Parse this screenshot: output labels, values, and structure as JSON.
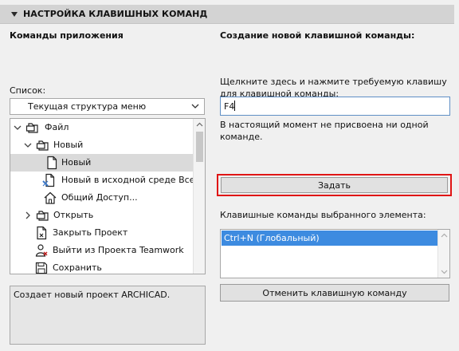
{
  "header": {
    "title": "НАСТРОЙКА КЛАВИШНЫХ КОМАНД"
  },
  "left": {
    "heading": "Команды приложения",
    "list_label": "Список:",
    "dropdown_value": "Текущая структура меню",
    "tree": [
      {
        "label": "Файл",
        "icon": "folder-icon",
        "expander": "chevron-down"
      },
      {
        "label": "Новый",
        "icon": "folder-icon",
        "expander": "chevron-down"
      },
      {
        "label": "Новый",
        "icon": "document-icon",
        "expander": "",
        "selected": true
      },
      {
        "label": "Новый в исходной среде Все",
        "icon": "new-doc-icon",
        "expander": ""
      },
      {
        "label": "Общий Доступ...",
        "icon": "house-icon",
        "expander": ""
      },
      {
        "label": "Открыть",
        "icon": "folder-icon",
        "expander": "chevron-right"
      },
      {
        "label": "Закрыть Проект",
        "icon": "close-doc-icon",
        "expander": ""
      },
      {
        "label": "Выйти из Проекта Teamwork",
        "icon": "user-exit-icon",
        "expander": ""
      },
      {
        "label": "Сохранить",
        "icon": "save-icon",
        "expander": ""
      }
    ],
    "description": "Создает новый проект ARCHICAD."
  },
  "right": {
    "heading": "Создание новой клавишной команды:",
    "instruction": "Щелкните здесь и нажмите требуемую клавишу для клавишной команды:",
    "key_input_value": "F4",
    "status_text": "В настоящий момент не присвоена ни одной команде.",
    "set_button_label": "Задать",
    "shortcuts_label": "Клавишные команды выбранного элемента:",
    "shortcuts": [
      "Ctrl+N (Глобальный)"
    ],
    "cancel_button_label": "Отменить клавишную команду"
  },
  "colors": {
    "selection": "#3d8be0",
    "highlight_outline": "#e01515"
  }
}
